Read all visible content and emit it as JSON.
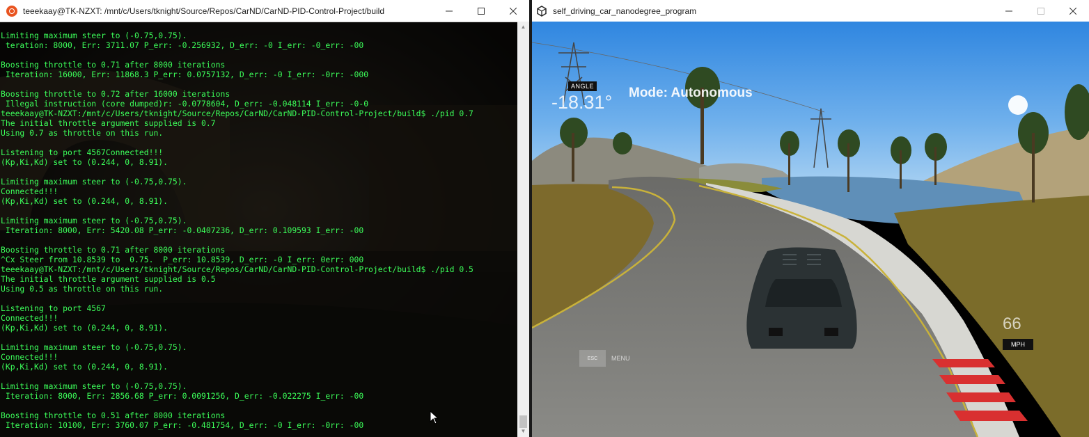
{
  "terminal": {
    "title": "teeekaay@TK-NZXT: /mnt/c/Users/tknight/Source/Repos/CarND/CarND-PID-Control-Project/build",
    "lines": [
      "Limiting maximum steer to (-0.75,0.75).",
      " teration: 8000, Err: 3711.07 P_err: -0.256932, D_err: -0 I_err: -0_err: -00",
      "",
      "Boosting throttle to 0.71 after 8000 iterations",
      " Iteration: 16000, Err: 11868.3 P_err: 0.0757132, D_err: -0 I_err: -0rr: -000",
      "",
      "Boosting throttle to 0.72 after 16000 iterations",
      " Illegal instruction (core dumped)r: -0.0778604, D_err: -0.048114 I_err: -0-0",
      "teeekaay@TK-NZXT:/mnt/c/Users/tknight/Source/Repos/CarND/CarND-PID-Control-Project/build$ ./pid 0.7",
      "The initial throttle argument supplied is 0.7",
      "Using 0.7 as throttle on this run.",
      "",
      "Listening to port 4567Connected!!!",
      "(Kp,Ki,Kd) set to (0.244, 0, 8.91).",
      "",
      "Limiting maximum steer to (-0.75,0.75).",
      "Connected!!!",
      "(Kp,Ki,Kd) set to (0.244, 0, 8.91).",
      "",
      "Limiting maximum steer to (-0.75,0.75).",
      " Iteration: 8000, Err: 5420.08 P_err: -0.0407236, D_err: 0.109593 I_err: -00",
      "",
      "Boosting throttle to 0.71 after 8000 iterations",
      "^Cx Steer from 10.8539 to  0.75.  P_err: 10.8539, D_err: -0 I_err: 0err: 000",
      "teeekaay@TK-NZXT:/mnt/c/Users/tknight/Source/Repos/CarND/CarND-PID-Control-Project/build$ ./pid 0.5",
      "The initial throttle argument supplied is 0.5",
      "Using 0.5 as throttle on this run.",
      "",
      "Listening to port 4567",
      "Connected!!!",
      "(Kp,Ki,Kd) set to (0.244, 0, 8.91).",
      "",
      "Limiting maximum steer to (-0.75,0.75).",
      "Connected!!!",
      "(Kp,Ki,Kd) set to (0.244, 0, 8.91).",
      "",
      "Limiting maximum steer to (-0.75,0.75).",
      " Iteration: 8000, Err: 2856.68 P_err: 0.0091256, D_err: -0.022275 I_err: -00",
      "",
      "Boosting throttle to 0.51 after 8000 iterations",
      " Iteration: 10100, Err: 3760.07 P_err: -0.481754, D_err: -0 I_err: -0rr: -00"
    ],
    "text_color": "#3cff5a",
    "icon": "ubuntu-icon"
  },
  "simulator": {
    "title": "self_driving_car_nanodegree_program",
    "icon": "unity-icon",
    "hud": {
      "angle_label": "ANGLE",
      "angle_value": "-18.31°",
      "mode": "Mode: Autonomous",
      "speed_value": "66",
      "speed_unit": "MPH",
      "esc_label": "ESC",
      "menu_label": "MENU"
    }
  }
}
